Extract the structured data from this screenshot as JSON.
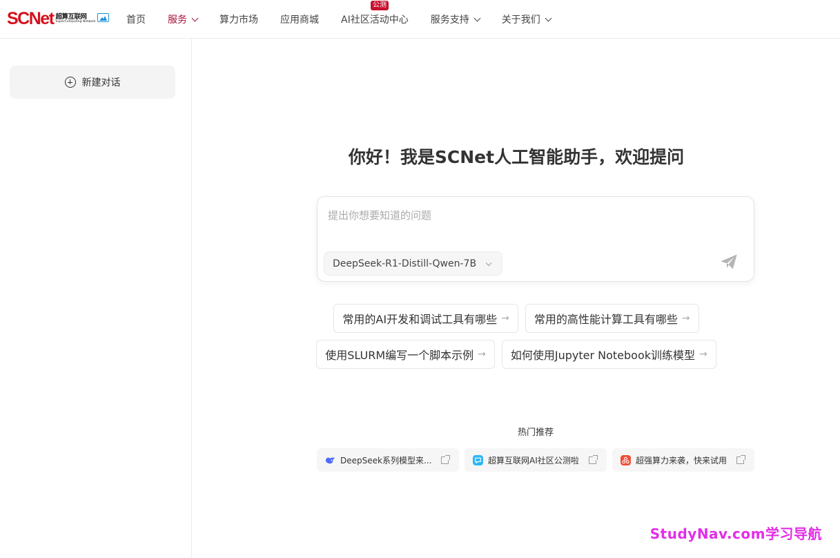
{
  "logo": {
    "brand_sc": "SC",
    "brand_net": "Net",
    "cn": "超算互联网",
    "en": "SuperComputing Network"
  },
  "nav": {
    "items": [
      {
        "label": "首页",
        "active": false,
        "dropdown": false
      },
      {
        "label": "服务",
        "active": true,
        "dropdown": true
      },
      {
        "label": "算力市场",
        "active": false,
        "dropdown": false
      },
      {
        "label": "应用商城",
        "active": false,
        "dropdown": false
      },
      {
        "label": "AI社区",
        "active": false,
        "dropdown": false,
        "badge": "公测"
      },
      {
        "label": "活动中心",
        "active": false,
        "dropdown": false
      },
      {
        "label": "服务支持",
        "active": false,
        "dropdown": true
      },
      {
        "label": "关于我们",
        "active": false,
        "dropdown": true
      }
    ]
  },
  "sidebar": {
    "new_chat_label": "新建对话"
  },
  "main": {
    "welcome": "你好！我是SCNet人工智能助手，欢迎提问",
    "input_placeholder": "提出你想要知道的问题",
    "model_selected": "DeepSeek-R1-Distill-Qwen-7B",
    "suggestions": [
      "常用的AI开发和调试工具有哪些",
      "常用的高性能计算工具有哪些",
      "使用SLURM编写一个脚本示例",
      "如何使用Jupyter Notebook训练模型"
    ],
    "hot_title": "热门推荐",
    "hot_items": [
      {
        "label": "DeepSeek系列模型来...",
        "icon": "deepseek-whale-icon",
        "color": "#4d6bfe"
      },
      {
        "label": "超算互联网AI社区公测啦",
        "icon": "chat-bubble-icon",
        "color": "#2db7f5"
      },
      {
        "label": "超强算力来袭，快来试用",
        "icon": "compute-icon",
        "color": "#f04e37"
      }
    ]
  },
  "watermark": "StudyNav.com学习导航",
  "colors": {
    "brand_red": "#d6101b",
    "nav_active": "#a3123a",
    "badge_red": "#c8102e",
    "watermark": "#e22ee8"
  }
}
